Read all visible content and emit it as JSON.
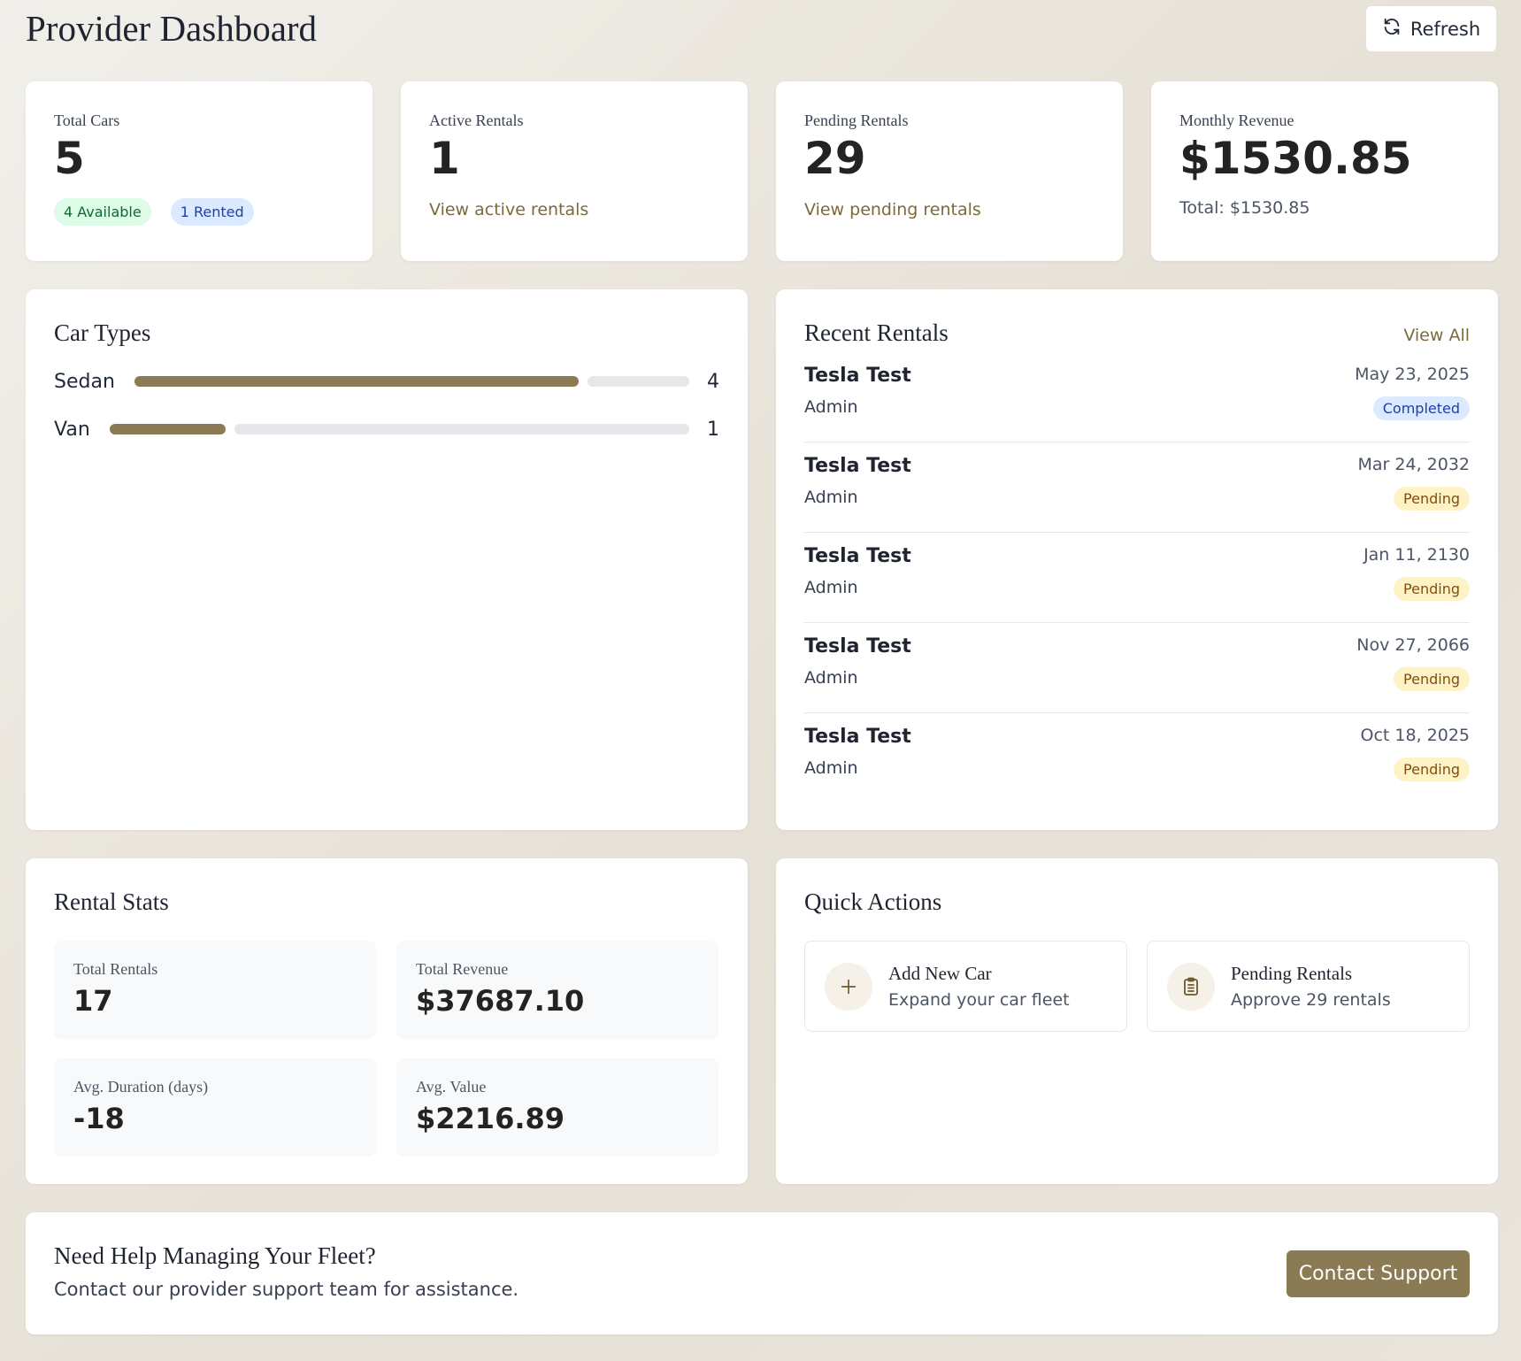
{
  "header": {
    "title": "Provider Dashboard",
    "refresh_label": "Refresh"
  },
  "stats": {
    "total_cars": {
      "label": "Total Cars",
      "value": "5",
      "available": "4 Available",
      "rented": "1 Rented"
    },
    "active_rentals": {
      "label": "Active Rentals",
      "value": "1",
      "link": "View active rentals"
    },
    "pending_rentals": {
      "label": "Pending Rentals",
      "value": "29",
      "link": "View pending rentals"
    },
    "monthly_revenue": {
      "label": "Monthly Revenue",
      "value": "$1530.85",
      "total": "Total: $1530.85"
    }
  },
  "car_types": {
    "title": "Car Types",
    "items": [
      {
        "label": "Sedan",
        "count": "4",
        "fraction": 0.8
      },
      {
        "label": "Van",
        "count": "1",
        "fraction": 0.2
      }
    ]
  },
  "recent_rentals": {
    "title": "Recent Rentals",
    "view_all": "View All",
    "items": [
      {
        "car": "Tesla Test",
        "user": "Admin",
        "date": "May 23, 2025",
        "status": "Completed"
      },
      {
        "car": "Tesla Test",
        "user": "Admin",
        "date": "Mar 24, 2032",
        "status": "Pending"
      },
      {
        "car": "Tesla Test",
        "user": "Admin",
        "date": "Jan 11, 2130",
        "status": "Pending"
      },
      {
        "car": "Tesla Test",
        "user": "Admin",
        "date": "Nov 27, 2066",
        "status": "Pending"
      },
      {
        "car": "Tesla Test",
        "user": "Admin",
        "date": "Oct 18, 2025",
        "status": "Pending"
      }
    ]
  },
  "rental_stats": {
    "title": "Rental Stats",
    "total_rentals": {
      "label": "Total Rentals",
      "value": "17"
    },
    "total_revenue": {
      "label": "Total Revenue",
      "value": "$37687.10"
    },
    "avg_duration": {
      "label": "Avg. Duration (days)",
      "value": "-18"
    },
    "avg_value": {
      "label": "Avg. Value",
      "value": "$2216.89"
    }
  },
  "quick_actions": {
    "title": "Quick Actions",
    "add_car": {
      "title": "Add New Car",
      "subtitle": "Expand your car fleet",
      "icon": "plus-icon"
    },
    "pending": {
      "title": "Pending Rentals",
      "subtitle": "Approve 29 rentals",
      "icon": "clipboard-icon"
    }
  },
  "help": {
    "title": "Need Help Managing Your Fleet?",
    "text": "Contact our provider support team for assistance.",
    "button": "Contact Support"
  },
  "colors": {
    "accent": "#8b7b55",
    "link": "#7c6a3a",
    "completed_bg": "#dbeafe",
    "pending_bg": "#fef3c7"
  }
}
